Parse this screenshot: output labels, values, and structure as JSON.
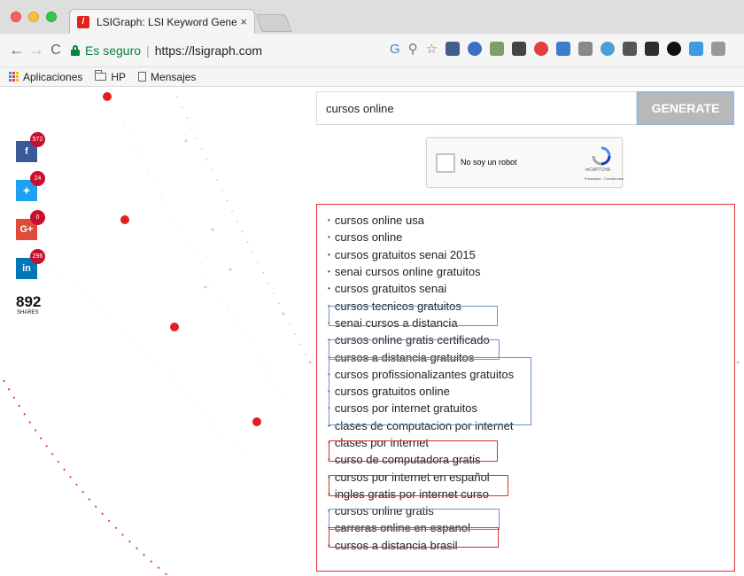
{
  "browser": {
    "tab_title": "LSIGraph: LSI Keyword Genera",
    "tab_close": "×",
    "secure_label": "Es seguro",
    "url_separator": "|",
    "url": "https://lsigraph.com",
    "bookmarks": [
      {
        "label": "Aplicaciones",
        "icon": "apps-icon"
      },
      {
        "label": "HP",
        "icon": "folder-icon"
      },
      {
        "label": "Mensajes",
        "icon": "document-icon"
      }
    ],
    "extension_colors": [
      "#3f5f8a",
      "#3a6fc4",
      "#7da06b",
      "#444444",
      "#e04040",
      "#3b7fc8",
      "#888888",
      "#4b9fd8",
      "#555555",
      "#2e2e2e",
      "#111111",
      "#3d9be0",
      "#999999"
    ]
  },
  "share": {
    "buttons": [
      {
        "network": "facebook",
        "glyph": "f",
        "count": "572",
        "color": "#3b5998"
      },
      {
        "network": "twitter",
        "glyph": "✦",
        "count": "24",
        "color": "#1da1f2"
      },
      {
        "network": "google-plus",
        "glyph": "G+",
        "count": "0",
        "color": "#dd4b39"
      },
      {
        "network": "linkedin",
        "glyph": "in",
        "count": "296",
        "color": "#0077b5"
      }
    ],
    "total": "892",
    "total_label": "SHARES"
  },
  "search": {
    "value": "cursos online",
    "button_label": "GENERATE"
  },
  "captcha": {
    "label": "No soy un robot",
    "brand": "reCAPTCHA",
    "terms": "Privacidad · Condiciones"
  },
  "results": {
    "keywords": [
      "cursos online usa",
      "cursos online",
      "cursos gratuitos senai 2015",
      "senai cursos online gratuitos",
      "cursos gratuitos senai",
      "cursos tecnicos gratuitos",
      "senai cursos a distancia",
      "cursos online gratis certificado",
      "cursos a distancia gratuitos",
      "cursos profissionalizantes gratuitos",
      "cursos gratuitos online",
      "cursos por internet gratuitos",
      "clases de computacion por internet",
      "clases por internet",
      "curso de computadora gratis",
      "cursos por internet en español",
      "ingles gratis por internet curso",
      "cursos online gratis",
      "carreras online en espanol",
      "cursos a distancia brasil"
    ]
  },
  "colors": {
    "accent_red": "#e03030",
    "highlight_blue": "#6e8fd0",
    "generate_bg": "#b8b8b8"
  }
}
